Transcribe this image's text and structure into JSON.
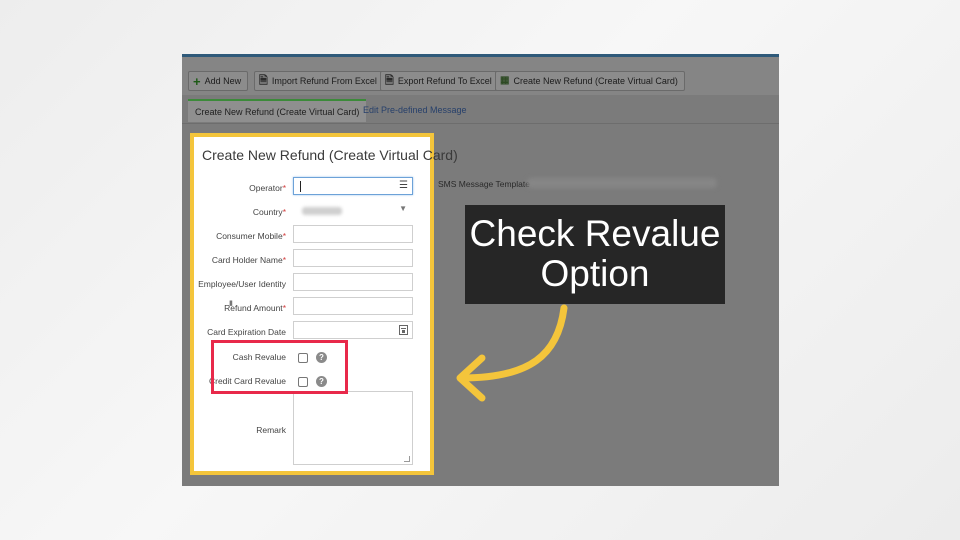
{
  "toolbar": {
    "buttons": [
      {
        "label": "Add New",
        "icon": "plus-icon"
      },
      {
        "label": "Import Refund From Excel",
        "icon": "file-icon"
      },
      {
        "label": "Export Refund To Excel",
        "icon": "file-icon"
      },
      {
        "label": "Create New Refund (Create Virtual Card)",
        "icon": "excel-card-icon"
      }
    ]
  },
  "tabs": [
    {
      "label": "Create New Refund (Create Virtual Card)",
      "active": true
    },
    {
      "label": "Edit Pre-defined Message",
      "active": false
    }
  ],
  "sms": {
    "label": "SMS Message Template"
  },
  "form": {
    "title": "Create New Refund (Create Virtual Card)",
    "fields": {
      "operator": {
        "label": "Operator",
        "required": "*"
      },
      "country": {
        "label": "Country",
        "required": "*"
      },
      "consumer_mobile": {
        "label": "Consumer Mobile",
        "required": "*"
      },
      "card_holder_name": {
        "label": "Card Holder Name",
        "required": "*"
      },
      "employee_identity": {
        "label": "Employee/User Identity"
      },
      "refund_amount": {
        "label": "Refund Amount",
        "required": "*"
      },
      "card_expiration_date": {
        "label": "Card Expiration Date"
      },
      "cash_revalue": {
        "label": "Cash Revalue"
      },
      "credit_card_revalue": {
        "label": "Credit Card Revalue"
      },
      "remark": {
        "label": "Remark"
      }
    },
    "help_glyph": "?"
  },
  "callout": {
    "line1": "Check Revalue",
    "line2": "Option"
  },
  "colors": {
    "highlight_border": "#f4c53b",
    "revalue_box": "#e8294a",
    "arrow": "#f4c53b",
    "callout_bg": "#262626"
  }
}
